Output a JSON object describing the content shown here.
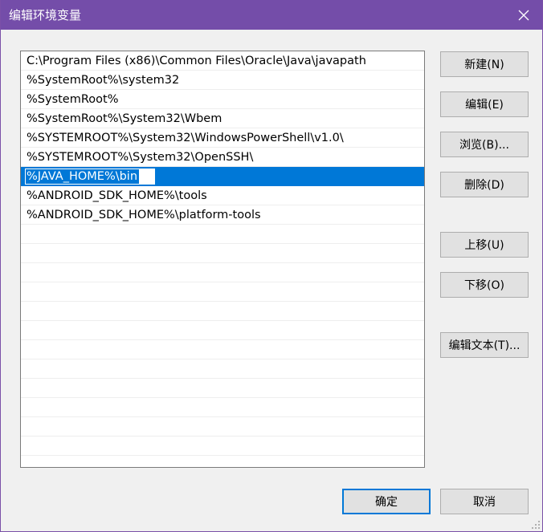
{
  "window": {
    "title": "编辑环境变量",
    "close_icon": "close-icon",
    "title_bar_color": "#744da9"
  },
  "list": {
    "items": [
      "C:\\Program Files (x86)\\Common Files\\Oracle\\Java\\javapath",
      "%SystemRoot%\\system32",
      "%SystemRoot%",
      "%SystemRoot%\\System32\\Wbem",
      "%SYSTEMROOT%\\System32\\WindowsPowerShell\\v1.0\\",
      "%SYSTEMROOT%\\System32\\OpenSSH\\",
      "%JAVA_HOME%\\bin",
      "%ANDROID_SDK_HOME%\\tools",
      "%ANDROID_SDK_HOME%\\platform-tools"
    ],
    "selected_index": 6,
    "editing_value": "%JAVA_HOME%\\bin",
    "selection_color": "#0078d7"
  },
  "buttons": {
    "new": "新建(N)",
    "edit": "编辑(E)",
    "browse": "浏览(B)...",
    "delete": "删除(D)",
    "move_up": "上移(U)",
    "move_down": "下移(O)",
    "edit_text": "编辑文本(T)...",
    "ok": "确定",
    "cancel": "取消"
  }
}
